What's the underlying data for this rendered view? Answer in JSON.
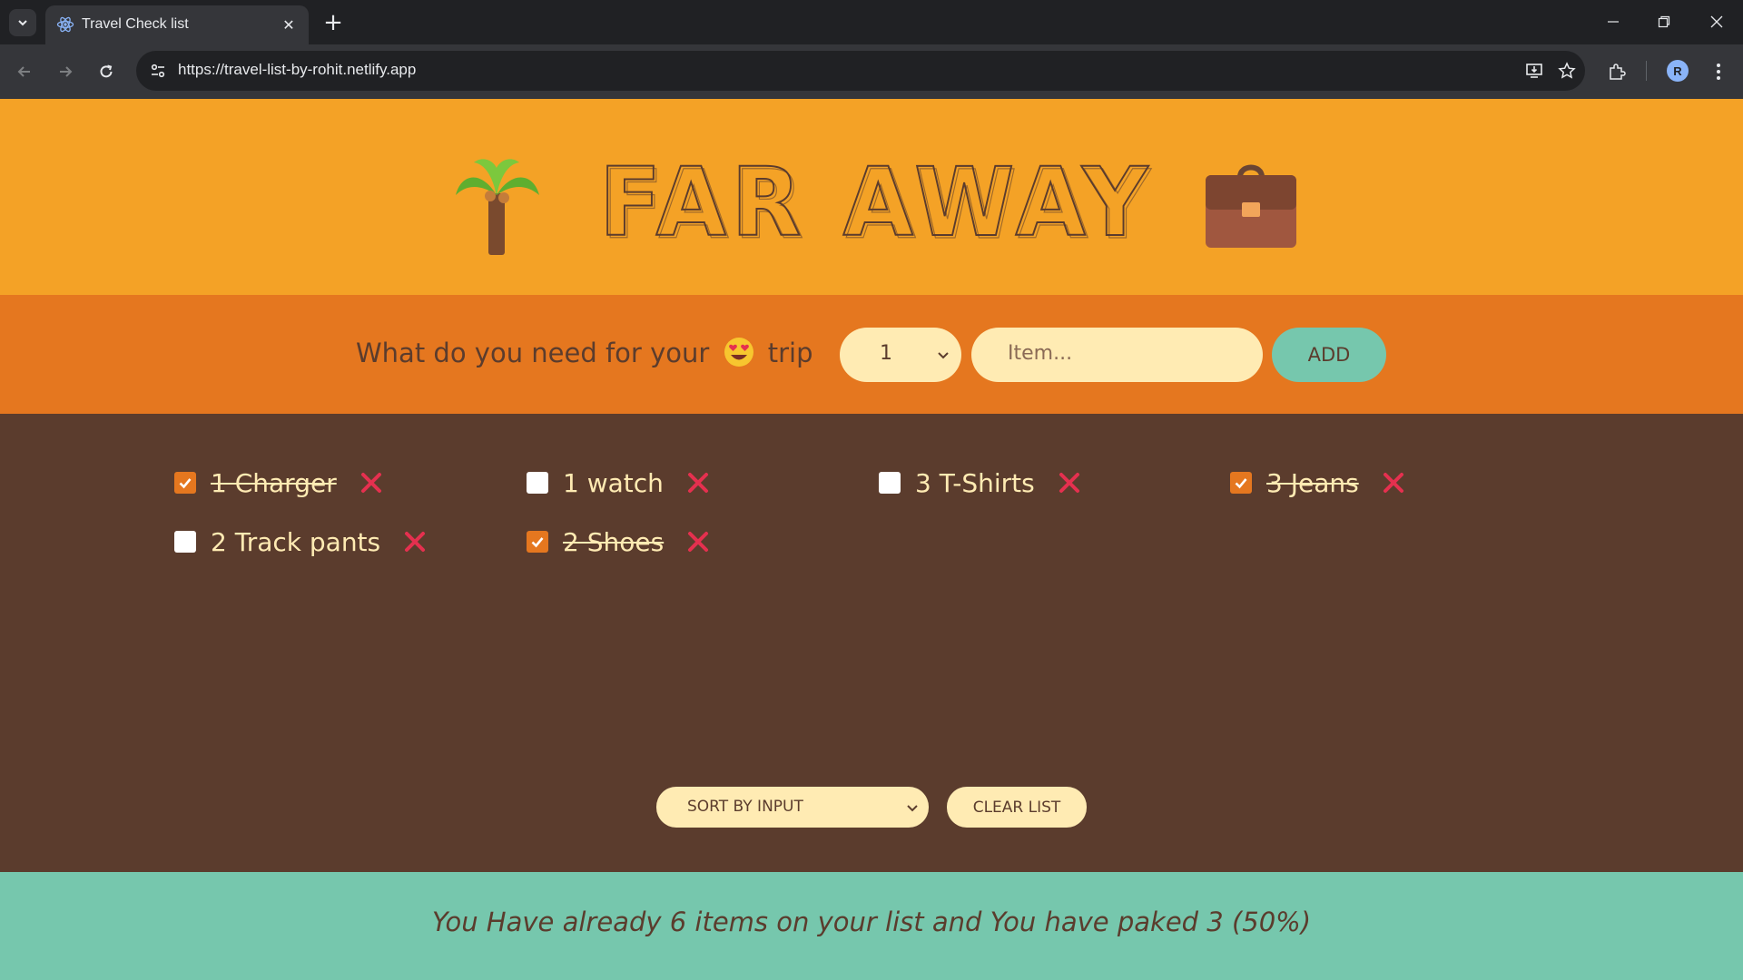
{
  "browser": {
    "tab_title": "Travel Check list",
    "url": "https://travel-list-by-rohit.netlify.app",
    "profile_initial": "R"
  },
  "header": {
    "title": "FAR AWAY",
    "left_icon": "palm-tree-icon",
    "right_icon": "briefcase-icon"
  },
  "form": {
    "question_prefix": "What do you need for your",
    "question_emoji": "heart-eyes-emoji",
    "question_suffix": "trip",
    "quantity_selected": "1",
    "item_placeholder": "Item...",
    "add_label": "ADD"
  },
  "items": [
    {
      "quantity": 1,
      "description": "Charger",
      "text": "1 Charger",
      "packed": true
    },
    {
      "quantity": 1,
      "description": "watch",
      "text": "1 watch",
      "packed": false
    },
    {
      "quantity": 3,
      "description": "T-Shirts",
      "text": "3 T-Shirts",
      "packed": false
    },
    {
      "quantity": 3,
      "description": "Jeans",
      "text": "3 Jeans",
      "packed": true
    },
    {
      "quantity": 2,
      "description": "Track pants",
      "text": "2 Track pants",
      "packed": false
    },
    {
      "quantity": 2,
      "description": "Shoes",
      "text": "2 Shoes",
      "packed": true
    }
  ],
  "actions": {
    "sort_selected": "SORT BY INPUT",
    "clear_label": "CLEAR LIST"
  },
  "footer": {
    "stats_text": "You Have already 6 items on your list and You have paked 3 (50%)"
  },
  "colors": {
    "header_bg": "#f4a226",
    "form_bg": "#e5771f",
    "list_bg": "#5b3c2d",
    "footer_bg": "#76c7ad",
    "cream": "#ffebb3",
    "delete_red": "#e5304f"
  }
}
